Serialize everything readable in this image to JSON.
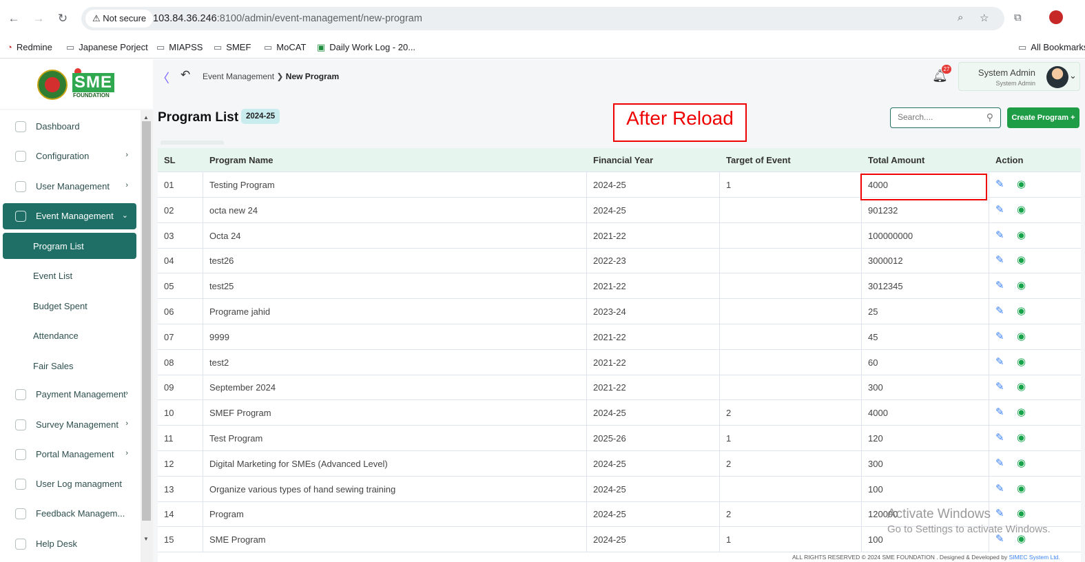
{
  "browser": {
    "security_label": "Not secure",
    "url_host": "103.84.36.246",
    "url_path": ":8100/admin/event-management/new-program",
    "bookmarks": [
      "Redmine",
      "Japanese Porject",
      "MIAPSS",
      "SMEF",
      "MoCAT",
      "Daily Work Log - 20...",
      "All Bookmarks"
    ]
  },
  "logo": {
    "text": "SME",
    "subtitle": "FOUNDATION"
  },
  "breadcrumb": {
    "parent": "Event Management",
    "current": "New Program"
  },
  "notifications": {
    "count": "27"
  },
  "user": {
    "name": "System Admin",
    "role": "System Admin"
  },
  "sidebar": {
    "items": [
      {
        "label": "Dashboard"
      },
      {
        "label": "Configuration"
      },
      {
        "label": "User Management"
      },
      {
        "label": "Event Management"
      },
      {
        "label": "Payment Management"
      },
      {
        "label": "Survey Management"
      },
      {
        "label": "Portal Management"
      },
      {
        "label": "User Log managment"
      },
      {
        "label": "Feedback Managem..."
      },
      {
        "label": "Help Desk"
      }
    ],
    "sub_items": [
      {
        "label": "Program List"
      },
      {
        "label": "Event List"
      },
      {
        "label": "Budget Spent"
      },
      {
        "label": "Attendance"
      },
      {
        "label": "Fair Sales"
      }
    ]
  },
  "page": {
    "title": "Program List",
    "fiscal_year": "2024-25",
    "annotation": "After Reload",
    "search_placeholder": "Search....",
    "create_button": "Create Program +"
  },
  "table": {
    "headers": [
      "SL",
      "Program Name",
      "Financial Year",
      "Target of Event",
      "Total Amount",
      "Action"
    ],
    "rows": [
      {
        "sl": "01",
        "name": "Testing Program",
        "year": "2024-25",
        "target": "1",
        "amount": "4000"
      },
      {
        "sl": "02",
        "name": "octa new 24",
        "year": "2024-25",
        "target": "",
        "amount": "901232"
      },
      {
        "sl": "03",
        "name": "Octa 24",
        "year": "2021-22",
        "target": "",
        "amount": "100000000"
      },
      {
        "sl": "04",
        "name": "test26",
        "year": "2022-23",
        "target": "",
        "amount": "3000012"
      },
      {
        "sl": "05",
        "name": "test25",
        "year": "2021-22",
        "target": "",
        "amount": "3012345"
      },
      {
        "sl": "06",
        "name": "Programe jahid",
        "year": "2023-24",
        "target": "",
        "amount": "25"
      },
      {
        "sl": "07",
        "name": "9999",
        "year": "2021-22",
        "target": "",
        "amount": "45"
      },
      {
        "sl": "08",
        "name": "test2",
        "year": "2021-22",
        "target": "",
        "amount": "60"
      },
      {
        "sl": "09",
        "name": "September 2024",
        "year": "2021-22",
        "target": "",
        "amount": "300"
      },
      {
        "sl": "10",
        "name": "SMEF Program",
        "year": "2024-25",
        "target": "2",
        "amount": "4000"
      },
      {
        "sl": "11",
        "name": "Test Program",
        "year": "2025-26",
        "target": "1",
        "amount": "120"
      },
      {
        "sl": "12",
        "name": "Digital Marketing for SMEs (Advanced Level)",
        "year": "2024-25",
        "target": "2",
        "amount": "300"
      },
      {
        "sl": "13",
        "name": "Organize various types of hand sewing training",
        "year": "2024-25",
        "target": "",
        "amount": "100"
      },
      {
        "sl": "14",
        "name": "Program",
        "year": "2024-25",
        "target": "2",
        "amount": "120000"
      },
      {
        "sl": "15",
        "name": "SME Program",
        "year": "2024-25",
        "target": "1",
        "amount": "100"
      }
    ]
  },
  "watermark": {
    "line1": "Activate Windows",
    "line2": "Go to Settings to activate Windows."
  },
  "footer": {
    "text": "ALL RIGHTS RESERVED © 2024 SME FOUNDATION . Designed & Developed by",
    "link": "SIMEC System Ltd."
  },
  "colors": {
    "primary": "#1f6f66",
    "create_button": "#1f9d46",
    "header_row": "#e6f5ee",
    "annotation": "#ee0000"
  }
}
